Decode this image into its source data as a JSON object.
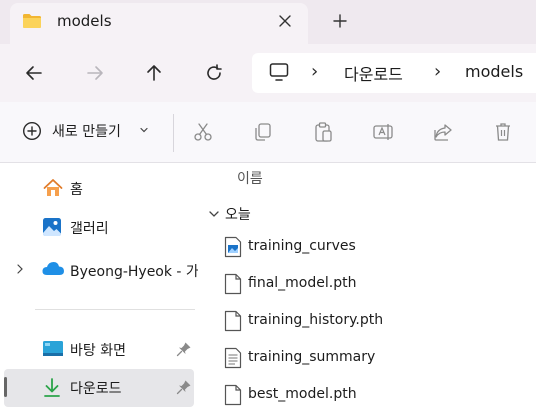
{
  "window": {
    "tab_title": "models",
    "tab_icon": "folder-icon"
  },
  "navigation": {
    "breadcrumb": [
      "다운로드",
      "models"
    ],
    "location_icon": "computer-icon"
  },
  "command_bar": {
    "new_label": "새로 만들기",
    "tools": [
      "cut-icon",
      "copy-icon",
      "paste-icon",
      "rename-icon",
      "share-icon",
      "delete-icon"
    ]
  },
  "sidebar": {
    "items": [
      {
        "label": "홈",
        "icon": "home-icon"
      },
      {
        "label": "갤러리",
        "icon": "gallery-icon"
      },
      {
        "label": "Byeong-Hyeok - 가",
        "icon": "onedrive-icon"
      },
      {
        "label": "바탕 화면",
        "icon": "desktop-icon",
        "pinned": true
      },
      {
        "label": "다운로드",
        "icon": "download-icon",
        "pinned": true,
        "selected": true
      }
    ]
  },
  "file_list": {
    "column_header": "이름",
    "group_label": "오늘",
    "files": [
      {
        "name": "training_curves",
        "icon": "image-file-icon"
      },
      {
        "name": "final_model.pth",
        "icon": "file-icon"
      },
      {
        "name": "training_history.pth",
        "icon": "file-icon"
      },
      {
        "name": "training_summary",
        "icon": "text-file-icon"
      },
      {
        "name": "best_model.pth",
        "icon": "file-icon"
      }
    ]
  },
  "colors": {
    "folder": "#f7c546",
    "accent": "#1a73c8",
    "onedrive": "#1f8fe6",
    "download_green": "#2ca44a"
  }
}
